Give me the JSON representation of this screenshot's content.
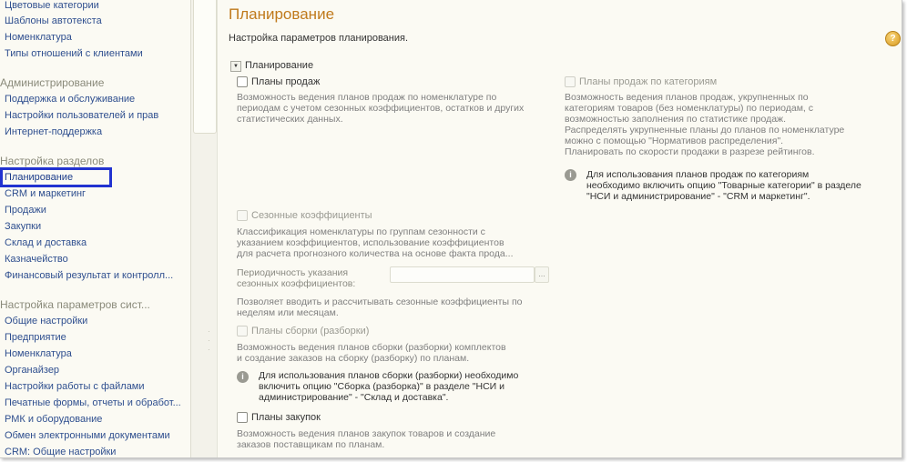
{
  "sidebar": {
    "top_items": [
      {
        "label": "Цветовые категории"
      },
      {
        "label": "Шаблоны автотекста"
      },
      {
        "label": "Номенклатура"
      },
      {
        "label": "Типы отношений с клиентами"
      }
    ],
    "groups": [
      {
        "title": "Администрирование",
        "items": [
          {
            "label": "Поддержка и обслуживание"
          },
          {
            "label": "Настройки пользователей и прав"
          },
          {
            "label": "Интернет-поддержка"
          }
        ]
      },
      {
        "title": "Настройка разделов",
        "items": [
          {
            "label": "Планирование"
          },
          {
            "label": "CRM и маркетинг"
          },
          {
            "label": "Продажи"
          },
          {
            "label": "Закупки"
          },
          {
            "label": "Склад и доставка"
          },
          {
            "label": "Казначейство"
          },
          {
            "label": "Финансовый результат и контролл..."
          }
        ]
      },
      {
        "title": "Настройка параметров сист...",
        "items": [
          {
            "label": "Общие настройки"
          },
          {
            "label": "Предприятие"
          },
          {
            "label": "Номенклатура"
          },
          {
            "label": "Органайзер"
          },
          {
            "label": "Настройки работы с файлами"
          },
          {
            "label": "Печатные формы, отчеты и обработ..."
          },
          {
            "label": "РМК и оборудование"
          },
          {
            "label": "Обмен электронными документами"
          },
          {
            "label": "CRM: Общие настройки"
          }
        ]
      }
    ]
  },
  "main": {
    "title": "Планирование",
    "subtitle": "Настройка параметров планирования.",
    "help": "?",
    "section_label": "Планирование",
    "sales_plans": {
      "label": "Планы продаж",
      "desc": [
        "Возможность ведения планов продаж по номенклатуре по",
        "периодам с учетом сезонных коэффициентов, остатков и других",
        "статистических данных."
      ]
    },
    "category_plans": {
      "label": "Планы продаж по категориям",
      "desc": [
        "Возможность ведения планов продаж, укрупненных по",
        "категориям товаров (без номенклатуры) по периодам, с",
        "возможностью заполнения по статистике продаж.",
        "Распределять укрупненные планы до планов по номенклатуре",
        "можно с помощью \"Нормативов распределения\".",
        "Планировать по скорости продажи в разрезе рейтингов."
      ],
      "info": [
        "Для использования планов продаж по категориям",
        "необходимо включить опцию \"Товарные категории\" в разделе",
        "\"НСИ и администрирование\" - \"CRM и маркетинг\"."
      ]
    },
    "seasonal": {
      "label": "Сезонные коэффициенты",
      "desc": [
        "Классификация номенклатуры по группам сезонности с",
        "указанием коэффициентов, использование коэффициентов",
        "для расчета прогнозного количества на основе факта прода..."
      ],
      "field_label": [
        "Периодичность указания",
        "сезонных коэффициентов:"
      ],
      "field_button": "...",
      "field_desc": [
        "Позволяет вводить и рассчитывать сезонные коэффициенты по",
        "неделям или месяцам."
      ]
    },
    "assembly": {
      "label": "Планы сборки (разборки)",
      "desc": [
        "Возможность ведения планов сборки (разборки) комплектов",
        "и создание заказов на сборку (разборку) по планам."
      ],
      "info": [
        "Для использования планов сборки (разборки) необходимо",
        "включить опцию \"Сборка (разборка)\" в разделе \"НСИ и",
        "администрирование\" - \"Склад и доставка\"."
      ]
    },
    "purchases": {
      "label": "Планы закупок",
      "desc": [
        "Возможность ведения планов закупок товаров и создание",
        "заказов поставщикам по планам."
      ]
    },
    "info_glyph": "i"
  }
}
